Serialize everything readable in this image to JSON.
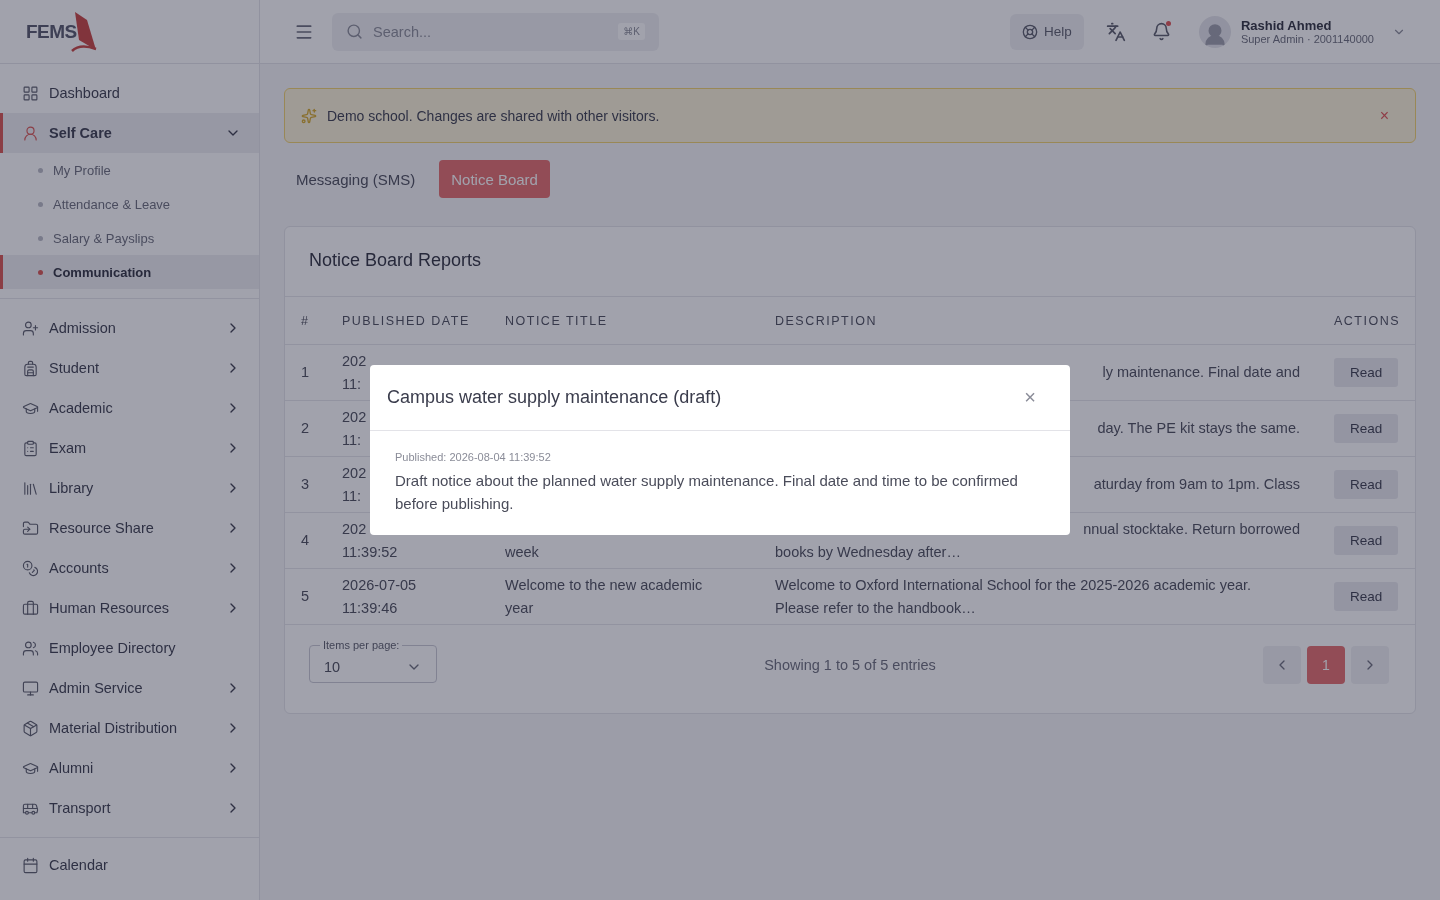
{
  "brand": {
    "name": "FEMS"
  },
  "sidebar": {
    "groups": [
      [
        {
          "label": "Dashboard",
          "selected": false
        },
        {
          "label": "Self Care",
          "expanded": true,
          "selected": true,
          "children": [
            {
              "label": "My Profile",
              "selected": false
            },
            {
              "label": "Attendance & Leave",
              "selected": false
            },
            {
              "label": "Salary & Payslips",
              "selected": false
            },
            {
              "label": "Communication",
              "selected": true
            }
          ]
        }
      ],
      [
        {
          "label": "Admission",
          "expanded": false,
          "selected": false
        },
        {
          "label": "Student",
          "expanded": false,
          "selected": false
        },
        {
          "label": "Academic",
          "expanded": false,
          "selected": false
        },
        {
          "label": "Exam",
          "expanded": false,
          "selected": false
        },
        {
          "label": "Library",
          "expanded": false,
          "selected": false
        },
        {
          "label": "Resource Share",
          "expanded": false,
          "selected": false
        },
        {
          "label": "Accounts",
          "expanded": false,
          "selected": false
        },
        {
          "label": "Human Resources",
          "expanded": false,
          "selected": false
        },
        {
          "label": "Employee Directory",
          "selected": false
        },
        {
          "label": "Admin Service",
          "expanded": false,
          "selected": false
        },
        {
          "label": "Material Distribution",
          "expanded": false,
          "selected": false
        },
        {
          "label": "Alumni",
          "expanded": false,
          "selected": false
        },
        {
          "label": "Transport",
          "expanded": false,
          "selected": false
        }
      ],
      [
        {
          "label": "Calendar",
          "selected": false
        }
      ]
    ]
  },
  "topbar": {
    "search": {
      "placeholder": "Search...",
      "shortcut": "⌘K"
    },
    "help": "Help",
    "notifications_unread": true,
    "user": {
      "name": "Rashid Ahmed",
      "role": "Super Admin · 2001140000"
    }
  },
  "banner": {
    "text": "Demo school. Changes are shared with other visitors.",
    "close": "×"
  },
  "tabs": [
    {
      "label": "Messaging (SMS)",
      "selected": false
    },
    {
      "label": "Notice Board",
      "selected": true
    }
  ],
  "card": {
    "title": "Notice Board Reports",
    "table": {
      "columns": [
        "#",
        "PUBLISHED DATE",
        "NOTICE TITLE",
        "DESCRIPTION",
        "ACTIONS"
      ],
      "rows": [
        {
          "index": "1",
          "date": [
            "202",
            "11:"
          ],
          "title": [],
          "description": [
            {
              "text": "ly maintenance. Final date and",
              "kind": "cut"
            }
          ],
          "action": "Read"
        },
        {
          "index": "2",
          "date": [
            "202",
            "11:"
          ],
          "title": [],
          "description": [
            {
              "text": "day. The PE kit stays the same.",
              "kind": "cut"
            }
          ],
          "action": "Read"
        },
        {
          "index": "3",
          "date": [
            "202",
            "11:"
          ],
          "title": [],
          "description": [
            {
              "text": "aturday from 9am to 1pm. Class",
              "kind": "cut"
            }
          ],
          "action": "Read"
        },
        {
          "index": "4",
          "date": [
            "202",
            "11:39:52"
          ],
          "title": [
            "week"
          ],
          "description": [
            {
              "text": "nnual stocktake. Return borrowed",
              "kind": "cut"
            },
            {
              "text": "books by Wednesday after…",
              "kind": "full"
            }
          ],
          "action": "Read"
        },
        {
          "index": "5",
          "date": [
            "2026-07-05",
            "11:39:46"
          ],
          "title": [
            "Welcome to the new academic",
            "year"
          ],
          "description": [
            {
              "text": "Welcome to Oxford International School for the 2025-2026 academic year.",
              "kind": "full"
            },
            {
              "text": "Please refer to the handbook…",
              "kind": "full"
            }
          ],
          "action": "Read"
        }
      ]
    },
    "footer": {
      "per_page_label": "Items per page:",
      "per_page": "10",
      "summary": "Showing 1 to 5 of 5 entries",
      "pages": [
        {
          "label": "1",
          "selected": true
        }
      ]
    }
  },
  "modal": {
    "title": "Campus water supply maintenance (draft)",
    "close": "×",
    "published": "Published: 2026-08-04 11:39:52",
    "body": "Draft notice about the planned water supply maintenance. Final date and time to be confirmed before publishing."
  }
}
